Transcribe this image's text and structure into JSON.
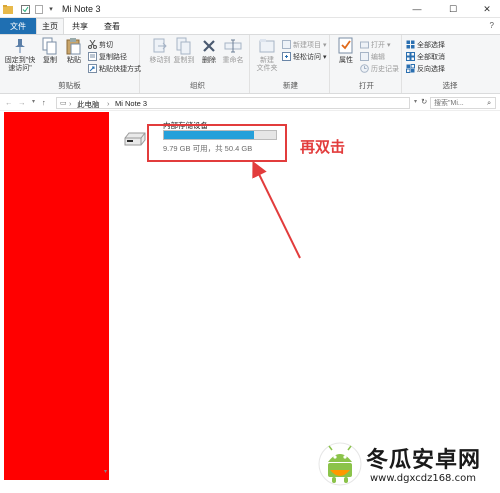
{
  "window": {
    "title": "Mi Note 3",
    "minimize_glyph": "—",
    "maximize_glyph": "☐",
    "close_glyph": "✕"
  },
  "tabs": {
    "file": "文件",
    "home": "主页",
    "share": "共享",
    "view": "查看"
  },
  "ribbon": {
    "clipboard": {
      "label": "剪贴板",
      "pin": "固定到\"快速访问\"",
      "copy": "复制",
      "paste": "粘贴",
      "cut": "剪切",
      "copy_path": "复制路径",
      "paste_shortcut": "粘贴快捷方式"
    },
    "organize": {
      "label": "组织",
      "move_to": "移动到",
      "copy_to": "复制到",
      "delete": "删除",
      "rename": "重命名"
    },
    "new": {
      "label": "新建",
      "new_folder": "新建\n文件夹",
      "new_item": "新建项目 ▾",
      "easy_access": "轻松访问 ▾"
    },
    "open": {
      "label": "打开",
      "properties": "属性",
      "open": "打开 ▾",
      "edit": "编辑",
      "history": "历史记录"
    },
    "select": {
      "label": "选择",
      "select_all": "全部选择",
      "select_none": "全部取消",
      "invert": "反向选择"
    }
  },
  "address": {
    "path_parent": "此电脑",
    "separator": "›",
    "path_current": "Mi Note 3",
    "search_placeholder": "搜索\"Mi..."
  },
  "drive": {
    "name": "内部存储设备",
    "space": "9.79 GB 可用，共 50.4 GB",
    "used_fraction": 0.806
  },
  "annotation": {
    "text": "再双击",
    "color": "#e23c3c"
  },
  "watermark": {
    "text": "冬瓜安卓网",
    "url": "www.dgxcdz168.com"
  },
  "colors": {
    "accent": "#1f6fb2",
    "progress": "#26a0da",
    "redaction": "#ff0000"
  }
}
